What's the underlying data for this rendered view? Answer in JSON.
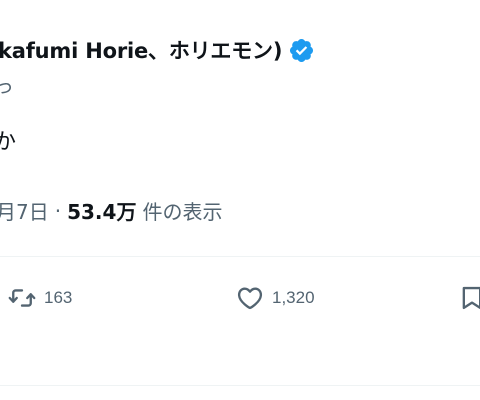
{
  "author": {
    "display_name": "kafumi Horie、ホリエモン)",
    "verified": true,
    "handle_fragment": "っ"
  },
  "tweet": {
    "body_fragment": "か"
  },
  "meta": {
    "date": "月7日",
    "separator": "·",
    "views_count": "53.4万",
    "views_label": "件の表示"
  },
  "actions": {
    "retweets": "163",
    "likes": "1,320"
  },
  "colors": {
    "text_primary": "#0f1419",
    "text_secondary": "#536471",
    "verified_badge": "#1d9bf0",
    "divider": "#eff3f4"
  }
}
